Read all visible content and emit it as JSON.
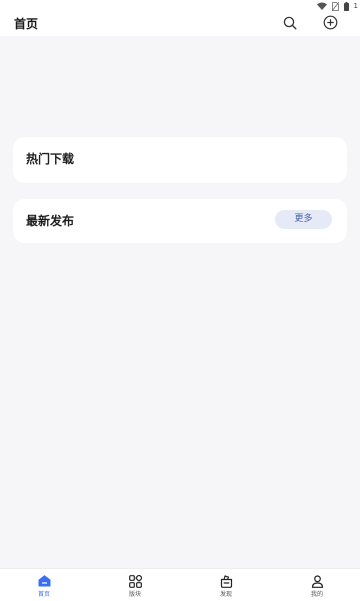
{
  "status_bar": {
    "battery_level": "1",
    "icons": [
      "wifi-icon",
      "no-sim-icon",
      "battery-icon"
    ]
  },
  "header": {
    "title": "首页",
    "icons": [
      "search-icon",
      "add-circle-icon"
    ]
  },
  "sections": {
    "hot_downloads": {
      "title": "热门下载"
    },
    "latest": {
      "title": "最新发布",
      "more_label": "更多"
    }
  },
  "bottom_nav": {
    "items": [
      {
        "label": "首页",
        "icon": "home-icon",
        "active": true
      },
      {
        "label": "版块",
        "icon": "grid-icon",
        "active": false
      },
      {
        "label": "发现",
        "icon": "discover-icon",
        "active": false
      },
      {
        "label": "我的",
        "icon": "person-icon",
        "active": false
      }
    ]
  },
  "colors": {
    "accent": "#3a6ff0",
    "background": "#f6f6f8",
    "more_button_bg": "#e6eaf6",
    "more_button_text": "#4a5fb0"
  }
}
